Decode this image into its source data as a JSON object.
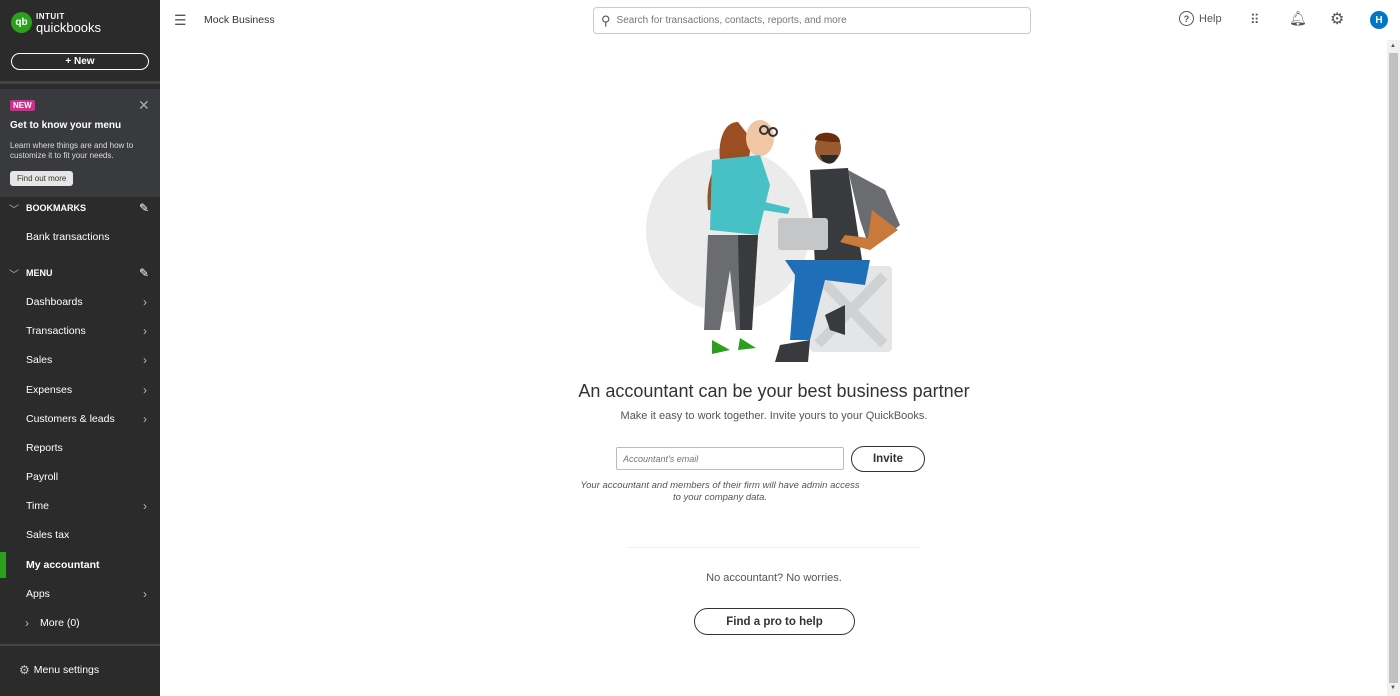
{
  "brand": {
    "intuit": "INTUIT",
    "product": "quickbooks",
    "logo_mark": "qb",
    "accent": "#2ca01c"
  },
  "sidebar": {
    "new_button": "+   New",
    "promo": {
      "badge": "NEW",
      "title": "Get to know your menu",
      "description": "Learn where things are and how to customize it to fit your needs.",
      "button": "Find out more"
    },
    "bookmarks": {
      "label": "BOOKMARKS",
      "items": [
        {
          "label": "Bank transactions"
        }
      ]
    },
    "menu": {
      "label": "MENU",
      "items": [
        {
          "label": "Dashboards",
          "has_arrow": true
        },
        {
          "label": "Transactions",
          "has_arrow": true
        },
        {
          "label": "Sales",
          "has_arrow": true
        },
        {
          "label": "Expenses",
          "has_arrow": true
        },
        {
          "label": "Customers & leads",
          "has_arrow": true
        },
        {
          "label": "Reports",
          "has_arrow": false
        },
        {
          "label": "Payroll",
          "has_arrow": false
        },
        {
          "label": "Time",
          "has_arrow": true
        },
        {
          "label": "Sales tax",
          "has_arrow": false
        },
        {
          "label": "My accountant",
          "has_arrow": false,
          "active": true
        },
        {
          "label": "Apps",
          "has_arrow": true
        }
      ],
      "more": "More (0)"
    },
    "menu_settings": "Menu settings"
  },
  "topbar": {
    "business_name": "Mock Business",
    "search_placeholder": "Search for transactions, contacts, reports, and more",
    "help": "Help",
    "avatar_initial": "H"
  },
  "main": {
    "heading": "An accountant can be your best business partner",
    "subheading": "Make it easy to work together. Invite yours to your QuickBooks.",
    "email_placeholder": "Accountant's email",
    "invite_button": "Invite",
    "note": "Your accountant and members of their firm will have admin access to your company data.",
    "no_accountant": "No accountant? No worries.",
    "find_pro_button": "Find a pro to help"
  }
}
